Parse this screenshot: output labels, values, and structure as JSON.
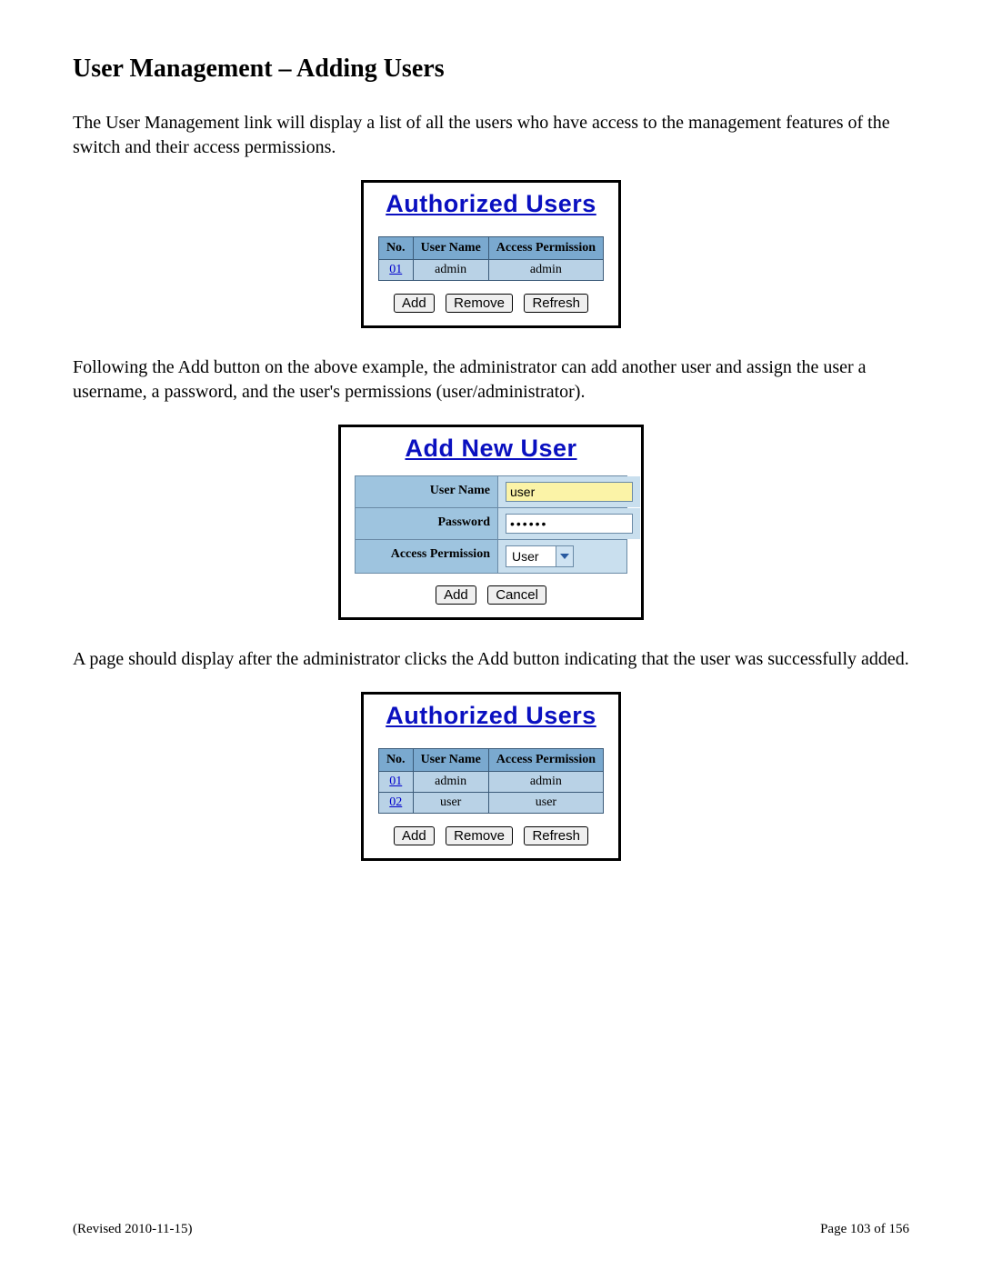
{
  "heading": "User Management – Adding Users",
  "para1": "The User Management link will display a list of all the users who have access to the management features of the switch and their access permissions.",
  "para2": "Following the Add button on the above example, the administrator can add another user and assign the user a username, a password, and the user's permissions (user/administrator).",
  "para3": "A page should display after the administrator clicks the Add button indicating that the user was successfully added.",
  "panel1": {
    "title": "Authorized Users",
    "headers": {
      "no": "No.",
      "name": "User Name",
      "perm": "Access Permission"
    },
    "rows": [
      {
        "no": "01",
        "name": "admin",
        "perm": "admin"
      }
    ],
    "buttons": {
      "add": "Add",
      "remove": "Remove",
      "refresh": "Refresh"
    }
  },
  "panel2": {
    "title": "Add New User",
    "labels": {
      "username": "User Name",
      "password": "Password",
      "perm": "Access Permission"
    },
    "values": {
      "username": "user",
      "password": "••••••",
      "perm": "User"
    },
    "buttons": {
      "add": "Add",
      "cancel": "Cancel"
    }
  },
  "panel3": {
    "title": "Authorized Users",
    "headers": {
      "no": "No.",
      "name": "User Name",
      "perm": "Access Permission"
    },
    "rows": [
      {
        "no": "01",
        "name": "admin",
        "perm": "admin"
      },
      {
        "no": "02",
        "name": "user",
        "perm": "user"
      }
    ],
    "buttons": {
      "add": "Add",
      "remove": "Remove",
      "refresh": "Refresh"
    }
  },
  "footer": {
    "left": "(Revised 2010-11-15)",
    "right": "Page 103 of 156"
  }
}
